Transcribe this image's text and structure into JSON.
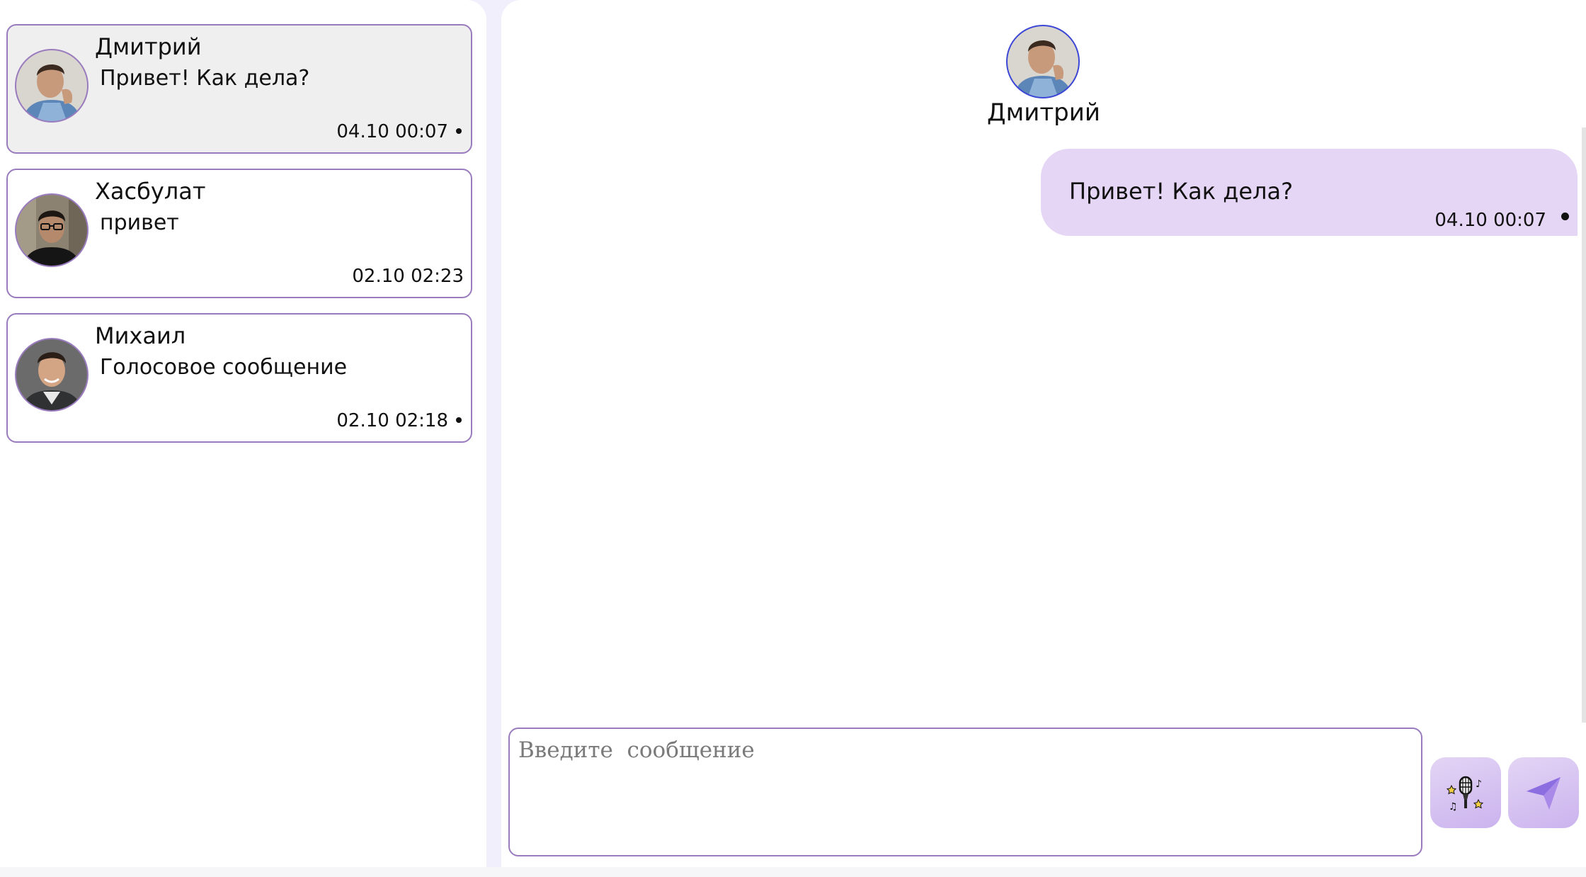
{
  "chats": [
    {
      "name": "Дмитрий",
      "preview": "Привет! Как дела?",
      "time": "04.10 00:07",
      "unread_dot": true,
      "active": true,
      "avatar": "avatar-dmitry"
    },
    {
      "name": "Хасбулат",
      "preview": "привет",
      "time": "02.10 02:23",
      "unread_dot": false,
      "active": false,
      "avatar": "avatar-khasbulat"
    },
    {
      "name": "Михаил",
      "preview": "Голосовое сообщение",
      "time": "02.10 02:18",
      "unread_dot": true,
      "active": false,
      "avatar": "avatar-mikhail"
    }
  ],
  "conversation": {
    "contact_name": "Дмитрий",
    "messages": [
      {
        "text": "Привет! Как дела?",
        "time": "04.10 00:07",
        "outgoing": true,
        "status_dot": true
      }
    ]
  },
  "composer": {
    "placeholder": "Введите  сообщение",
    "value": ""
  },
  "buttons": {
    "mic_icon": "microphone-icon",
    "send_icon": "send-arrow-icon"
  },
  "colors": {
    "accent_border": "#9a7cbe",
    "bubble_bg": "#e6d6f6",
    "active_card_bg": "#efeff0",
    "button_gradient_start": "#e3d5f5",
    "button_gradient_end": "#cbb3ee",
    "send_arrow": "#9b6fe6"
  }
}
